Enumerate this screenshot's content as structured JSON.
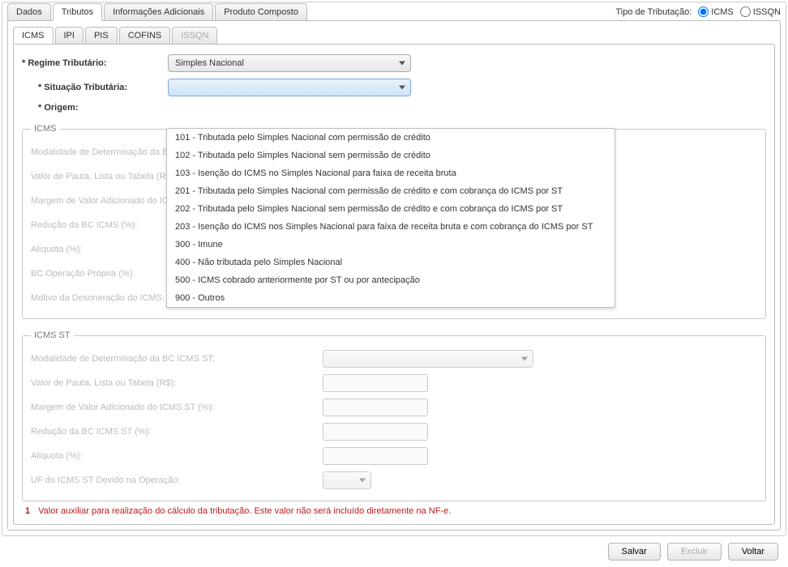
{
  "tipo_trib_label": "Tipo de Tributação:",
  "tipo_opts": {
    "icms": "ICMS",
    "issqn": "ISSQN"
  },
  "top_tabs": [
    "Dados",
    "Tributos",
    "Informações Adicionais",
    "Produto Composto"
  ],
  "sub_tabs": [
    "ICMS",
    "IPI",
    "PIS",
    "COFINS",
    "ISSQN"
  ],
  "labels": {
    "regime": "* Regime Tributário:",
    "situacao": "* Situação Tributária:",
    "origem": "* Origem:"
  },
  "regime_value": "Simples Nacional",
  "situacao_options": [
    "101 - Tributada pelo Simples Nacional com permissão de crédito",
    "102 - Tributada pelo Simples Nacional sem permissão de crédito",
    "103 - Isenção do ICMS no Simples Nacional para faixa de receita bruta",
    "201 - Tributada pelo Simples Nacional com permissão de crédito e com cobrança do ICMS por ST",
    "202 - Tributada pelo Simples Nacional sem permissão de crédito e com cobrança do ICMS por ST",
    "203 - Isenção do ICMS nos Simples Nacional para faixa de receita bruta e com cobrança do ICMS por ST",
    "300 - Imune",
    "400 - Não tributada pelo Simples Nacional",
    "500 - ICMS cobrado anteriormente por ST ou por antecipação",
    "900 - Outros"
  ],
  "group_icms": {
    "legend": "ICMS",
    "rows": [
      "Modalidade de Determinação da BC ICMS:",
      "Valor de Pauta, Lista ou Tabela (R$):",
      "Margem de Valor Adicionado do ICMS (%):",
      "Redução da BC ICMS (%):",
      "Alíquota (%):",
      "BC Operação Própria (%):",
      "Motivo da Desoneração do ICMS:"
    ]
  },
  "group_icms_st": {
    "legend": "ICMS ST",
    "rows": [
      "Modalidade de Determinação da BC ICMS ST:",
      "Valor de Pauta, Lista ou Tabela (R$):",
      "Margem de Valor Adicionado do ICMS ST (%):",
      "Redução da BC ICMS ST (%):",
      "Alíquota (%):",
      "UF do ICMS ST Devido na Operação:"
    ]
  },
  "note": {
    "num": "1",
    "text": "Valor auxiliar para realização do cálculo da tributação. Este valor não será incluído diretamente na NF-e."
  },
  "buttons": {
    "save": "Salvar",
    "delete": "Excluir",
    "back": "Voltar"
  }
}
